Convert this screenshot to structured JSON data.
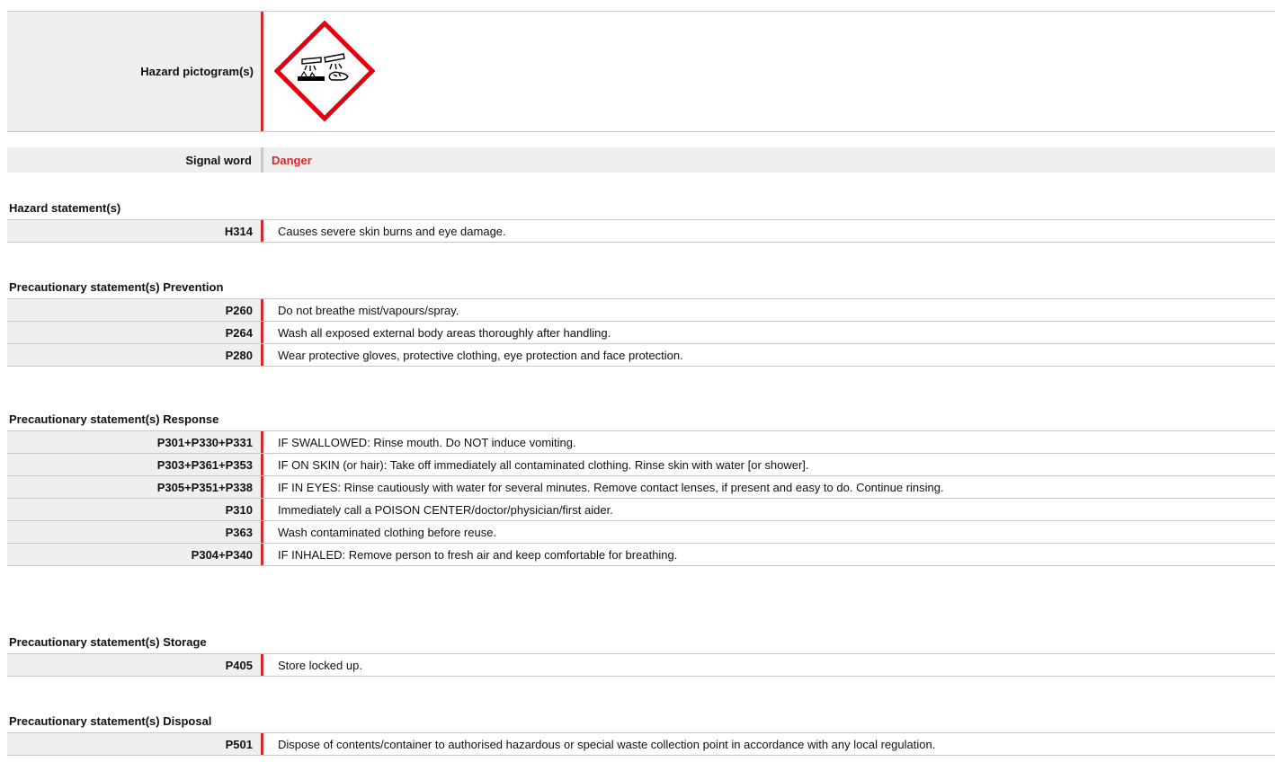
{
  "pictogram": {
    "label": "Hazard pictogram(s)",
    "icon": "corrosion-pictogram-icon"
  },
  "signal": {
    "label": "Signal word",
    "value": "Danger"
  },
  "hazard": {
    "title": "Hazard statement(s)",
    "rows": [
      {
        "code": "H314",
        "text": "Causes severe skin burns and eye damage."
      }
    ]
  },
  "prevention": {
    "title": "Precautionary statement(s) Prevention",
    "rows": [
      {
        "code": "P260",
        "text": "Do not breathe mist/vapours/spray."
      },
      {
        "code": "P264",
        "text": "Wash all exposed external body areas thoroughly after handling."
      },
      {
        "code": "P280",
        "text": "Wear protective gloves, protective clothing, eye protection and face protection."
      }
    ]
  },
  "response": {
    "title": "Precautionary statement(s) Response",
    "rows": [
      {
        "code": "P301+P330+P331",
        "text": "IF SWALLOWED: Rinse mouth. Do NOT induce vomiting."
      },
      {
        "code": "P303+P361+P353",
        "text": "IF ON SKIN (or hair): Take off immediately all contaminated clothing. Rinse skin with water [or shower]."
      },
      {
        "code": "P305+P351+P338",
        "text": "IF IN EYES: Rinse cautiously with water for several minutes. Remove contact lenses, if present and easy to do. Continue rinsing."
      },
      {
        "code": "P310",
        "text": "Immediately call a POISON CENTER/doctor/physician/first aider."
      },
      {
        "code": "P363",
        "text": "Wash contaminated clothing before reuse."
      },
      {
        "code": "P304+P340",
        "text": "IF INHALED: Remove person to fresh air and keep comfortable for breathing."
      }
    ]
  },
  "storage": {
    "title": "Precautionary statement(s) Storage",
    "rows": [
      {
        "code": "P405",
        "text": "Store locked up."
      }
    ]
  },
  "disposal": {
    "title": "Precautionary statement(s) Disposal",
    "rows": [
      {
        "code": "P501",
        "text": "Dispose of contents/container to authorised hazardous or special waste collection point in accordance with any local regulation."
      }
    ]
  },
  "colors": {
    "accent": "#d42a2a",
    "label_bg": "#efefef",
    "border": "#c8c8c8"
  }
}
